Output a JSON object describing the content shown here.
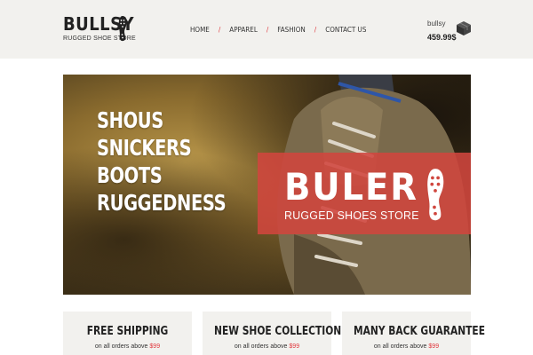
{
  "header": {
    "logo_title": "BULLSY",
    "logo_subtitle": "RUGGED SHOE STORE",
    "nav": [
      {
        "label": "HOME"
      },
      {
        "label": "APPAREL"
      },
      {
        "label": "FASHION"
      },
      {
        "label": "CONTACT US"
      }
    ],
    "nav_separator": "/",
    "cart": {
      "user": "bullsy",
      "total": "459.99$",
      "icon": "box-icon"
    }
  },
  "hero": {
    "headline_lines": [
      "SHOUS",
      "SNICKERS",
      "BOOTS",
      "RUGGEDNESS"
    ],
    "brand_name": "BULER",
    "brand_subtitle": "RUGGED SHOES STORE",
    "brand_color": "#d0463e",
    "icon": "shoe-sole-icon"
  },
  "features": [
    {
      "title": "FREE SHIPPING",
      "text": "on all orders above",
      "price": "$99"
    },
    {
      "title": "NEW SHOE COLLECTION",
      "text": "on all orders above",
      "price": "$99"
    },
    {
      "title": "MANY BACK GUARANTEE",
      "text": "on all orders above",
      "price": "$99"
    }
  ],
  "colors": {
    "accent": "#e0393e",
    "header_bg": "#f2f1ee"
  }
}
